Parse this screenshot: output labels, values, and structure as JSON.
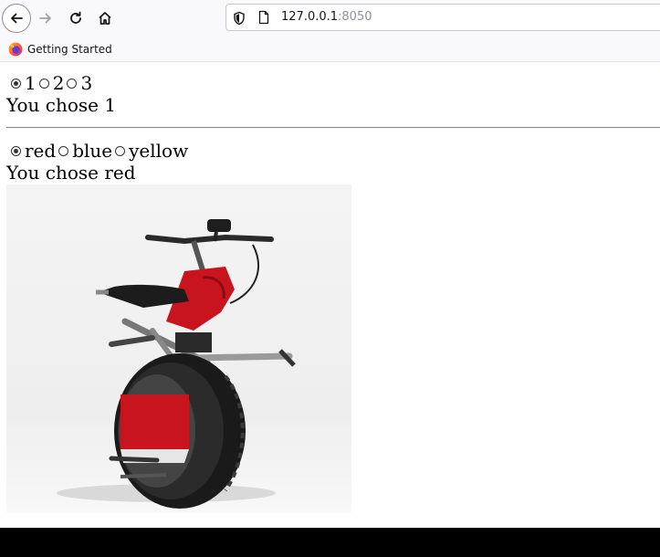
{
  "browser": {
    "url_host": "127.0.0.1",
    "url_port": ":8050",
    "bookmark_label": "Getting Started"
  },
  "radio_group_1": {
    "options": [
      "1",
      "2",
      "3"
    ],
    "selected": "1",
    "output": "You chose 1"
  },
  "radio_group_2": {
    "options": [
      "red",
      "blue",
      "yellow"
    ],
    "selected": "red",
    "output": "You chose red"
  },
  "image": {
    "subject": "monowheel-motorcycle",
    "accent_color": "#c8141e"
  },
  "colors": {
    "toolbar_bg": "#f9f9fb",
    "page_bg": "#ffffff",
    "bottom_bar": "#000000"
  }
}
